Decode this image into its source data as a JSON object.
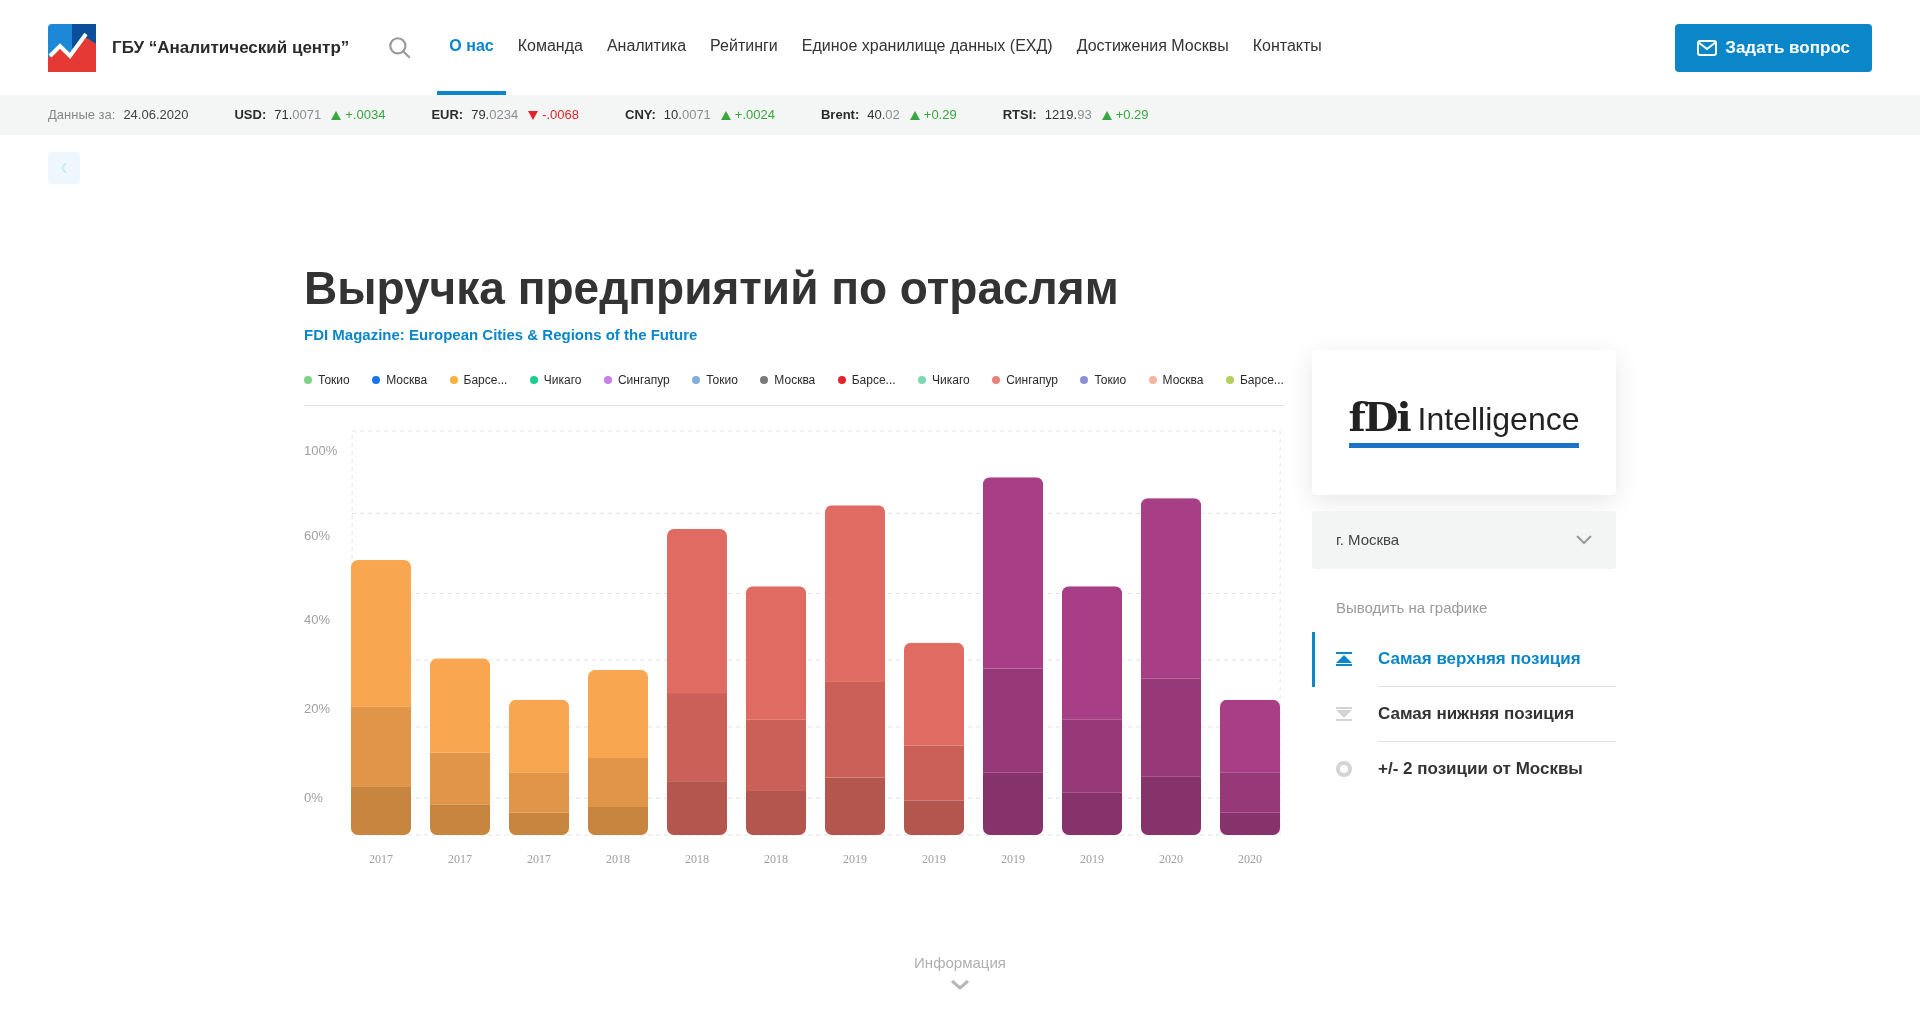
{
  "header": {
    "org_name": "ГБУ “Аналитический центр”",
    "nav": [
      {
        "label": "О нас",
        "selected": true
      },
      {
        "label": "Команда",
        "selected": false
      },
      {
        "label": "Аналитика",
        "selected": false
      },
      {
        "label": "Рейтинги",
        "selected": false
      },
      {
        "label": "Единое хранилище данных (ЕХД)",
        "selected": false
      },
      {
        "label": "Достижения Москвы",
        "selected": false
      },
      {
        "label": "Контакты",
        "selected": false
      }
    ],
    "ask_button": "Задать вопрос"
  },
  "ticker": {
    "date_label": "Данные за:",
    "date": "24.06.2020",
    "items": [
      {
        "label": "USD:",
        "value_main": "71.",
        "value_fraction": "0071",
        "rising": true,
        "change": "+.0034"
      },
      {
        "label": "EUR:",
        "value_main": "79.",
        "value_fraction": "0234",
        "rising": false,
        "change": "-.0068"
      },
      {
        "label": "CNY:",
        "value_main": "10.",
        "value_fraction": "0071",
        "rising": true,
        "change": "+.0024"
      },
      {
        "label": "Brent:",
        "value_main": "40.",
        "value_fraction": "02",
        "rising": true,
        "change": "+0.29"
      },
      {
        "label": "RTSI:",
        "value_main": "1219.",
        "value_fraction": "93",
        "rising": true,
        "change": "+0.29"
      }
    ]
  },
  "title": "Выручка предприятий по отраслям",
  "subtitle": "FDI Magazine: European Cities & Regions of the Future",
  "legend": [
    {
      "label": "Токио",
      "color": "#7bd389"
    },
    {
      "label": "Москва",
      "color": "#1a73e8"
    },
    {
      "label": "Барсе...",
      "color": "#f9b13c"
    },
    {
      "label": "Чикаго",
      "color": "#1ccf8f"
    },
    {
      "label": "Сингапур",
      "color": "#c77dea"
    },
    {
      "label": "Токио",
      "color": "#7fb0de"
    },
    {
      "label": "Москва",
      "color": "#7a7a7a"
    },
    {
      "label": "Барсе...",
      "color": "#e3242b"
    },
    {
      "label": "Чикаго",
      "color": "#7fd8b4"
    },
    {
      "label": "Сингапур",
      "color": "#e88080"
    },
    {
      "label": "Токио",
      "color": "#8f8fd8"
    },
    {
      "label": "Москва",
      "color": "#f7b4a0"
    },
    {
      "label": "Барсе...",
      "color": "#b5cf5a"
    }
  ],
  "chart": {
    "y_axis_labels": [
      "100%",
      "60%",
      "40%",
      "20%",
      "0%"
    ],
    "x_axis_labels": [
      "2017",
      "2017",
      "2017",
      "2018",
      "2018",
      "2018",
      "2019",
      "2019",
      "2019",
      "2019",
      "2020",
      "2020"
    ]
  },
  "side": {
    "partner_logo": {
      "mark": "fDi",
      "name": "Intelligence"
    },
    "city_select": "г. Москва",
    "options_label": "Выводить на графике",
    "options": [
      {
        "kind": "top",
        "label": "Самая верхняя позиция",
        "selected": true
      },
      {
        "kind": "bottom",
        "label": "Самая нижняя позиция",
        "selected": false
      },
      {
        "kind": "range",
        "label": "+/- 2 позиции от Москвы",
        "selected": false
      }
    ]
  },
  "footer_link": "Информация"
}
